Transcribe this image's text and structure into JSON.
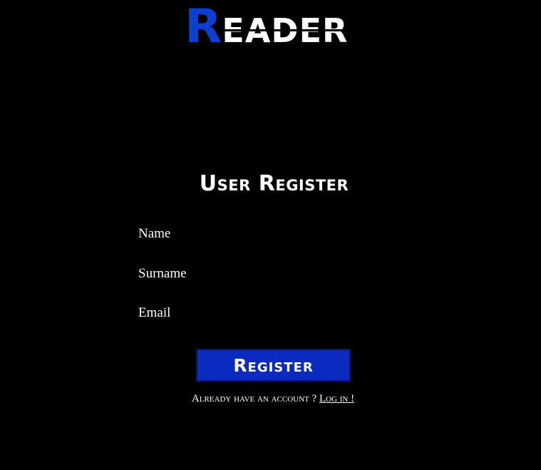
{
  "app": {
    "logo_first_letter": "R",
    "logo_rest": "EADER"
  },
  "form": {
    "title": "User Register",
    "fields": [
      {
        "label": "Name",
        "value": ""
      },
      {
        "label": "Surname",
        "value": ""
      },
      {
        "label": "Email",
        "value": ""
      }
    ],
    "submit_label": "Register"
  },
  "footer": {
    "prompt": "Already have an account ?",
    "login_link": "Log in !"
  },
  "colors": {
    "background": "#000000",
    "accent": "#0a3fd0",
    "button": "#0a2ac0",
    "text": "#ffffff"
  }
}
